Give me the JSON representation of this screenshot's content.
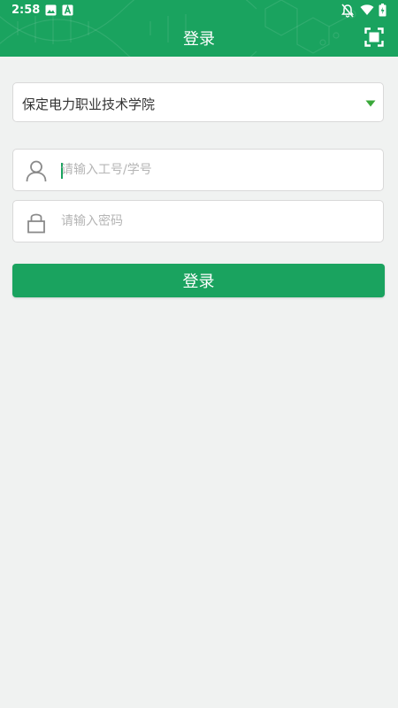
{
  "status_bar": {
    "time": "2:58",
    "left_icons": [
      "image-icon",
      "a-letter-icon"
    ],
    "right_icons": [
      "notification-off-icon",
      "wifi-icon",
      "battery-icon"
    ]
  },
  "header": {
    "title": "登录",
    "scan_icon": "scan-icon",
    "background_color": "#1aa35f"
  },
  "form": {
    "school": {
      "value": "保定电力职业技术学院",
      "arrow_color": "#3aa83a"
    },
    "username": {
      "placeholder": "请输入工号/学号",
      "icon": "user-icon"
    },
    "password": {
      "placeholder": "请输入密码",
      "icon": "lock-icon"
    },
    "login_button_label": "登录"
  },
  "colors": {
    "accent": "#1aa35f",
    "page_background": "#f0f2f1"
  }
}
